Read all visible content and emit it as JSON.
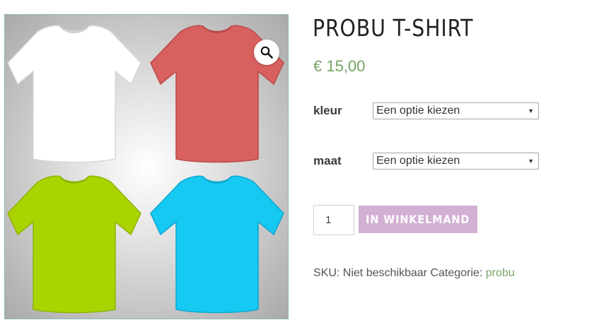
{
  "product": {
    "title": "PROBU T-SHIRT",
    "price": "€ 15,00",
    "image": {
      "shirt_colors": [
        "#ffffff",
        "#d8615f",
        "#a9d400",
        "#16c9f3"
      ]
    }
  },
  "variations": [
    {
      "label": "kleur",
      "placeholder": "Een optie kiezen"
    },
    {
      "label": "maat",
      "placeholder": "Een optie kiezen"
    }
  ],
  "cart": {
    "quantity": "1",
    "button_label": "IN WINKELMAND"
  },
  "meta": {
    "sku_label": "SKU:",
    "sku_value": "Niet beschikbaar",
    "category_label": "Categorie:",
    "category_value": "probu"
  },
  "icons": {
    "zoom": "magnifier-icon",
    "select_arrow": "triangle-down-icon"
  },
  "colors": {
    "price": "#77a464",
    "button": "#d2b0d3",
    "link": "#77a464"
  }
}
